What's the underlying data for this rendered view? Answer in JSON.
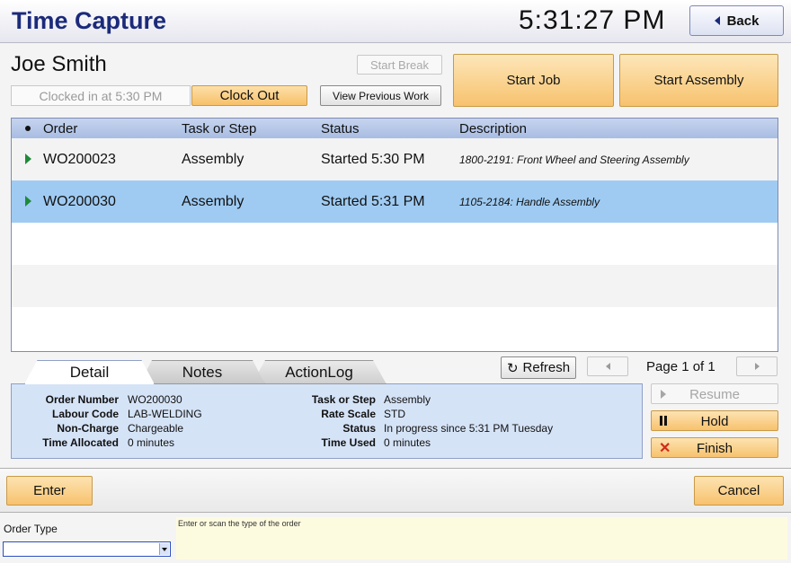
{
  "header": {
    "title": "Time Capture",
    "clock": "5:31:27 PM",
    "back_label": "Back"
  },
  "employee": {
    "name": "Joe Smith",
    "clocked_in": "Clocked in at 5:30 PM",
    "start_break_label": "Start Break",
    "clock_out_label": "Clock Out",
    "view_previous_label": "View Previous Work",
    "start_job_label": "Start Job",
    "start_assembly_label": "Start Assembly"
  },
  "jobs": {
    "columns": [
      "Order",
      "Task or Step",
      "Status",
      "Description"
    ],
    "rows": [
      {
        "order": "WO200023",
        "task": "Assembly",
        "status": "Started 5:30 PM",
        "description": "1800-2191: Front Wheel and Steering Assembly",
        "selected": false
      },
      {
        "order": "WO200030",
        "task": "Assembly",
        "status": "Started 5:31 PM",
        "description": "1105-2184: Handle Assembly",
        "selected": true
      }
    ]
  },
  "tabs": [
    {
      "label": "Detail",
      "active": true
    },
    {
      "label": "Notes",
      "active": false
    },
    {
      "label": "ActionLog",
      "active": false
    }
  ],
  "paging": {
    "refresh_label": "Refresh",
    "page_label": "Page 1 of 1"
  },
  "detail": {
    "left": [
      {
        "label": "Order Number",
        "value": "WO200030"
      },
      {
        "label": "Labour Code",
        "value": "LAB-WELDING"
      },
      {
        "label": "Non-Charge",
        "value": "Chargeable"
      },
      {
        "label": "Time Allocated",
        "value": "0 minutes"
      }
    ],
    "right": [
      {
        "label": "Task or Step",
        "value": "Assembly"
      },
      {
        "label": "Rate Scale",
        "value": "STD"
      },
      {
        "label": "Status",
        "value": "In progress since 5:31 PM Tuesday"
      },
      {
        "label": "Time Used",
        "value": "0 minutes"
      }
    ]
  },
  "actions": {
    "resume_label": "Resume",
    "hold_label": "Hold",
    "finish_label": "Finish"
  },
  "footer": {
    "enter_label": "Enter",
    "cancel_label": "Cancel",
    "order_type_label": "Order Type",
    "order_type_value": "",
    "hint": "Enter or scan the type of the order"
  },
  "colors": {
    "title": "#1b2a7a",
    "accent_orange": "#f7c26e",
    "selected_row": "#9fcbf2",
    "play_arrow": "#1f8a3a",
    "finish_x": "#d12a1c"
  }
}
